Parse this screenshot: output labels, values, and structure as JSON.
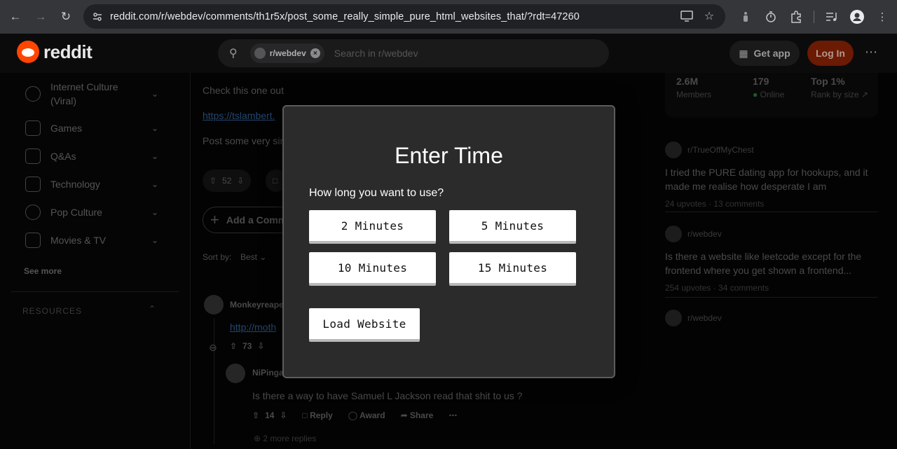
{
  "browser": {
    "url": "reddit.com/r/webdev/comments/th1r5x/post_some_really_simple_pure_html_websites_that/?rdt=47260"
  },
  "header": {
    "logo": "reddit",
    "search_chip": "r/webdev",
    "search_placeholder": "Search in r/webdev",
    "get_app": "Get app",
    "login": "Log In"
  },
  "sidebar": {
    "items": [
      {
        "label_line1": "Internet Culture",
        "label_line2": "(Viral)"
      },
      {
        "label": "Games"
      },
      {
        "label": "Q&As"
      },
      {
        "label": "Technology"
      },
      {
        "label": "Pop Culture"
      },
      {
        "label": "Movies & TV"
      }
    ],
    "see_more": "See more",
    "resources": "RESOURCES"
  },
  "main": {
    "comment_text": "Check this one out",
    "link": "https://tslambert.",
    "post_text": "Post some very sim",
    "vote_count": "52",
    "add_comment": "Add a Comm",
    "sort_by": "Sort by:",
    "sort_value": "Best",
    "commenter1": "Monkeyreape",
    "commenter1_link": "http://moth",
    "commenter1_votes": "73",
    "commenter2": "NiPinga",
    "reply_text": "Is there a way to have Samuel L Jackson read that shit to us ?",
    "reply_votes": "14",
    "reply_label": "Reply",
    "award_label": "Award",
    "share_label": "Share",
    "more_replies": "2 more replies"
  },
  "right_sidebar": {
    "stats": [
      {
        "value": "2.6M",
        "label": "Members"
      },
      {
        "value": "179",
        "label": "Online"
      },
      {
        "value": "Top 1%",
        "label": "Rank by size"
      }
    ],
    "posts": [
      {
        "sub": "r/TrueOffMyChest",
        "title": "I tried the PURE dating app for hookups, and it made me realise how desperate I am",
        "meta": "24 upvotes · 13 comments"
      },
      {
        "sub": "r/webdev",
        "title": "Is there a website like leetcode except for the frontend where you get shown a frontend...",
        "meta": "254 upvotes · 34 comments"
      },
      {
        "sub": "r/webdev",
        "title": "",
        "meta": ""
      }
    ]
  },
  "modal": {
    "title": "Enter Time",
    "question": "How long you want to use?",
    "options": [
      "2 Minutes",
      "5 Minutes",
      "10 Minutes",
      "15 Minutes"
    ],
    "load_button": "Load Website"
  }
}
